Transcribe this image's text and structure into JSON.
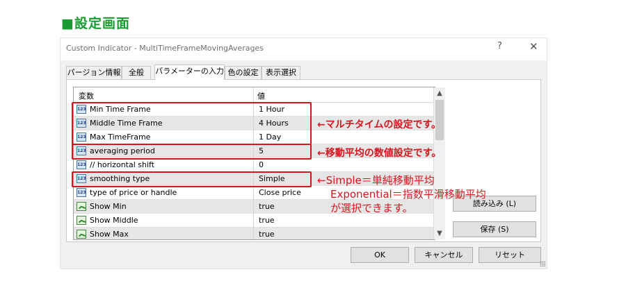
{
  "heading": "■設定画面",
  "window": {
    "title": "Custom Indicator - MultiTimeFrameMovingAverages",
    "help": "?",
    "close": "✕"
  },
  "tabs": [
    "パージョン情報",
    "全般",
    "パラメーターの入力",
    "色の設定",
    "表示選択"
  ],
  "grid": {
    "col_variable": "変数",
    "col_value": "値",
    "rows": [
      {
        "name": "Min Time Frame",
        "value": "1 Hour",
        "icon": "123"
      },
      {
        "name": "Middle Time Frame",
        "value": "4 Hours",
        "icon": "123"
      },
      {
        "name": "Max TimeFrame",
        "value": "1 Day",
        "icon": "123"
      },
      {
        "name": "averaging period",
        "value": "5",
        "icon": "123"
      },
      {
        "name": "// horizontal shift",
        "value": "0",
        "icon": "123"
      },
      {
        "name": "smoothing type",
        "value": "Simple",
        "icon": "123"
      },
      {
        "name": "type of price or handle",
        "value": "Close price",
        "icon": "123"
      },
      {
        "name": "Show Min",
        "value": "true",
        "icon": "bool"
      },
      {
        "name": "Show Middle",
        "value": "true",
        "icon": "bool"
      },
      {
        "name": "Show Max",
        "value": "true",
        "icon": "bool"
      }
    ]
  },
  "buttons": {
    "load": "読み込み (L)",
    "save": "保存 (S)",
    "ok": "OK",
    "cancel": "キャンセル",
    "reset": "リセット"
  },
  "annotations": {
    "multi_time": "←マルチタイムの設定です。",
    "ma_period": "←移動平均の数値設定です。",
    "simple": "←Simple＝単純移動平均",
    "exponential": "Exponential＝指数平滑移動平均",
    "selectable": "が選択できます。"
  },
  "colors": {
    "heading_green": "#1a9a33",
    "annotation_red": "#d8141c"
  }
}
